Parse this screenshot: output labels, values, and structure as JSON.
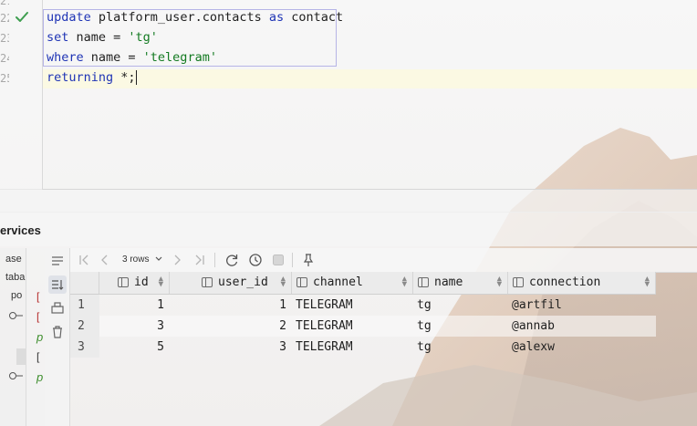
{
  "editor": {
    "line_numbers": [
      "22",
      "23",
      "24",
      "25"
    ],
    "lines": [
      {
        "tokens": [
          {
            "t": "update",
            "c": "kw"
          },
          {
            "t": " platform_user.contacts ",
            "c": ""
          },
          {
            "t": "as",
            "c": "kw"
          },
          {
            "t": " contact",
            "c": ""
          }
        ]
      },
      {
        "tokens": [
          {
            "t": "set",
            "c": "kw"
          },
          {
            "t": " name = ",
            "c": ""
          },
          {
            "t": "'tg'",
            "c": "str"
          }
        ]
      },
      {
        "tokens": [
          {
            "t": "where",
            "c": "kw"
          },
          {
            "t": " name = ",
            "c": ""
          },
          {
            "t": "'telegram'",
            "c": "str"
          }
        ]
      },
      {
        "tokens": [
          {
            "t": "returning",
            "c": "kw"
          },
          {
            "t": " *;",
            "c": ""
          }
        ]
      }
    ],
    "status_icon": "checkmark-icon",
    "colors": {
      "keyword": "#1f34b5",
      "string": "#137a21",
      "check": "#3e9e4f"
    }
  },
  "services": {
    "title": "ervices",
    "tree_items": [
      "ase",
      "taba",
      "po"
    ]
  },
  "toolbar": {
    "rows_label": "3 rows",
    "icons": [
      "first-page-icon",
      "prev-page-icon",
      "next-page-icon",
      "last-page-icon",
      "refresh-icon",
      "history-icon",
      "stop-icon",
      "pin-icon"
    ]
  },
  "table": {
    "columns": [
      "id",
      "user_id",
      "channel",
      "name",
      "connection"
    ],
    "rows": [
      {
        "num": "1",
        "id": "1",
        "user_id": "1",
        "channel": "TELEGRAM",
        "name": "tg",
        "connection": "@artfil"
      },
      {
        "num": "2",
        "id": "3",
        "user_id": "2",
        "channel": "TELEGRAM",
        "name": "tg",
        "connection": "@annab"
      },
      {
        "num": "3",
        "id": "5",
        "user_id": "3",
        "channel": "TELEGRAM",
        "name": "tg",
        "connection": "@alexw"
      }
    ]
  }
}
